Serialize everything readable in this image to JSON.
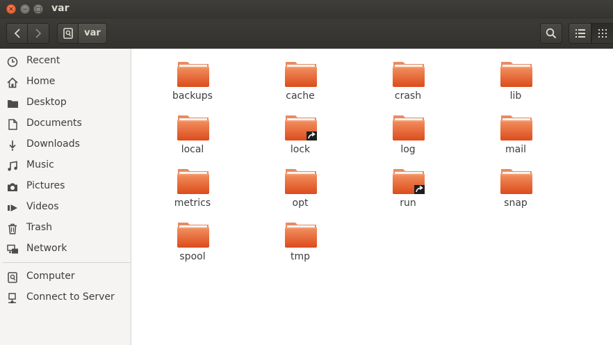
{
  "window": {
    "title": "var"
  },
  "toolbar": {
    "path_segment": "var"
  },
  "sidebar": {
    "places": [
      {
        "label": "Recent",
        "icon": "clock-icon"
      },
      {
        "label": "Home",
        "icon": "home-icon"
      },
      {
        "label": "Desktop",
        "icon": "folder-icon"
      },
      {
        "label": "Documents",
        "icon": "document-icon"
      },
      {
        "label": "Downloads",
        "icon": "download-icon"
      },
      {
        "label": "Music",
        "icon": "music-icon"
      },
      {
        "label": "Pictures",
        "icon": "camera-icon"
      },
      {
        "label": "Videos",
        "icon": "video-icon"
      },
      {
        "label": "Trash",
        "icon": "trash-icon"
      },
      {
        "label": "Network",
        "icon": "network-icon"
      }
    ],
    "devices": [
      {
        "label": "Computer",
        "icon": "computer-icon"
      },
      {
        "label": "Connect to Server",
        "icon": "server-icon"
      }
    ]
  },
  "files": [
    {
      "name": "backups",
      "link": false
    },
    {
      "name": "cache",
      "link": false
    },
    {
      "name": "crash",
      "link": false
    },
    {
      "name": "lib",
      "link": false
    },
    {
      "name": "local",
      "link": false
    },
    {
      "name": "lock",
      "link": true
    },
    {
      "name": "log",
      "link": false
    },
    {
      "name": "mail",
      "link": false
    },
    {
      "name": "metrics",
      "link": false
    },
    {
      "name": "opt",
      "link": false
    },
    {
      "name": "run",
      "link": true
    },
    {
      "name": "snap",
      "link": false
    },
    {
      "name": "spool",
      "link": false
    },
    {
      "name": "tmp",
      "link": false
    }
  ],
  "colors": {
    "folder_top": "#f08a5d",
    "folder_body": "#e2572a",
    "accent": "#e95420"
  }
}
